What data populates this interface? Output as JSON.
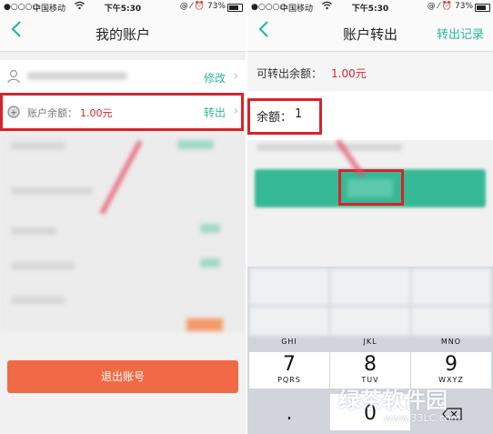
{
  "left": {
    "status": {
      "signal": "●○○○○",
      "carrier": "中国移动",
      "wifi_icon": "wifi-icon",
      "time": "下午5:30",
      "right": "@ ⁄ ⏰ 73%"
    },
    "nav": {
      "back_icon": "chevron-left-icon",
      "title": "我的账户"
    },
    "user_row": {
      "link": "修改"
    },
    "balance_row": {
      "label": "账户余额：",
      "value": "1.00元",
      "link": "转出"
    },
    "logout": "退出账号"
  },
  "right": {
    "status": {
      "signal": "●○○○○",
      "carrier": "中国移动",
      "wifi_icon": "wifi-icon",
      "time": "下午5:30",
      "right": "@ ⁄ ⏰ 73%"
    },
    "nav": {
      "back_icon": "chevron-left-icon",
      "title": "账户转出",
      "action": "转出记录"
    },
    "available": {
      "label": "可转出余额：",
      "value": "1.00元"
    },
    "amount": {
      "label": "余额：",
      "value": "1"
    },
    "keypad": {
      "row_labels": [
        "GHI",
        "JKL",
        "MNO"
      ],
      "keys": [
        {
          "digit": "7",
          "letters": "PQRS"
        },
        {
          "digit": "8",
          "letters": "TUV"
        },
        {
          "digit": "9",
          "letters": "WXYZ"
        }
      ],
      "zero": "0",
      "dot": "."
    }
  },
  "watermark": {
    "text": "绿茶软件园",
    "url": "www.33LC.com"
  },
  "colors": {
    "accent": "#27b89b",
    "highlight": "#d8232a",
    "logout": "#f26a45",
    "confirm": "#36b996"
  }
}
